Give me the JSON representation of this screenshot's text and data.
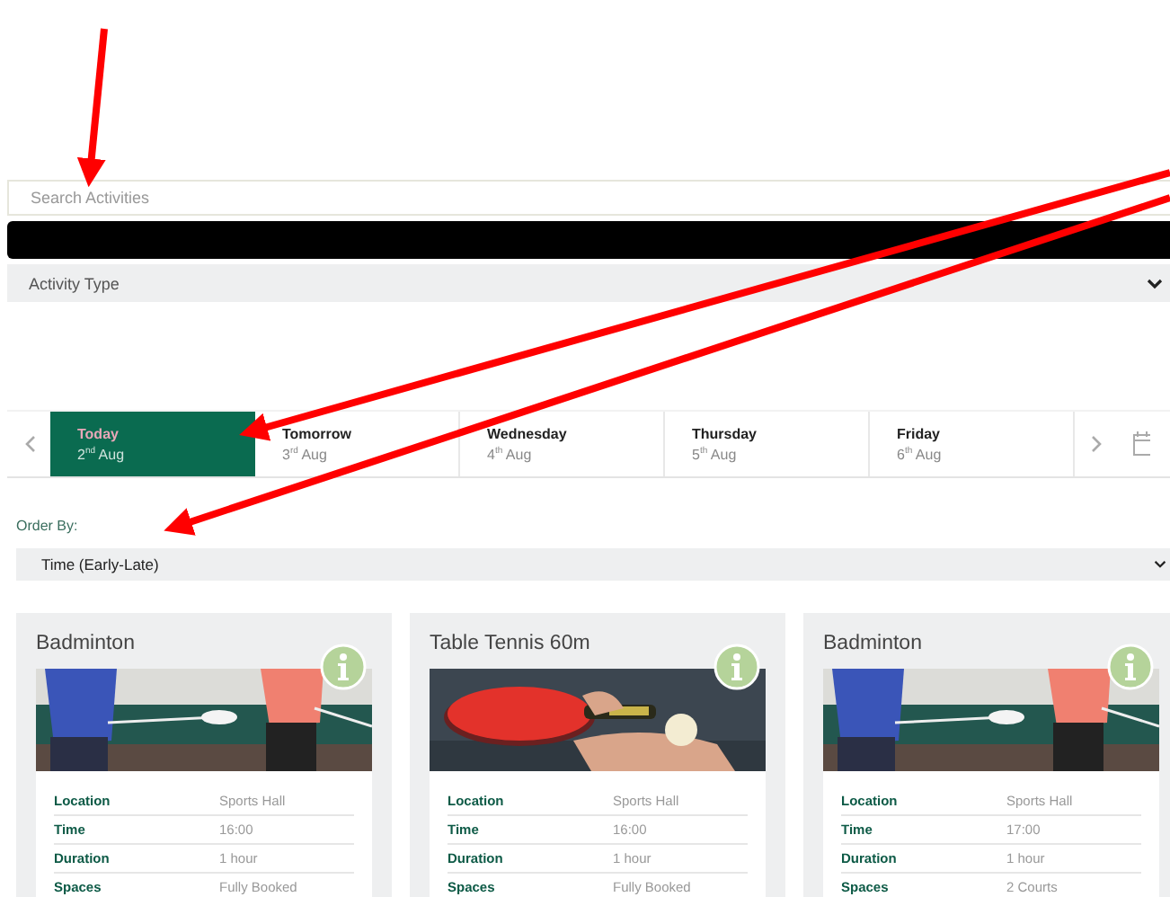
{
  "search": {
    "placeholder": "Search Activities"
  },
  "activity_type": {
    "value": "Activity Type"
  },
  "dates": [
    {
      "day": "Today",
      "date": "2$^{nd}$ Aug",
      "selected": true
    },
    {
      "day": "Tomorrow",
      "date": "3$^{rd}$ Aug",
      "selected": false
    },
    {
      "day": "Wednesday",
      "date": "4$^{th}$ Aug",
      "selected": false
    },
    {
      "day": "Thursday",
      "date": "5$^{th}$ Aug",
      "selected": false
    },
    {
      "day": "Friday",
      "date": "6$^{th}$ Aug",
      "selected": false
    }
  ],
  "order_by": {
    "label": "Order By:",
    "value": "Time (Early-Late)"
  },
  "cards": [
    {
      "title": "Badminton",
      "image": {
        "kind": "picture"
      },
      "details": [
        {
          "label": "Location",
          "value": "Sports Hall"
        },
        {
          "label": "Time",
          "value": "16:00"
        },
        {
          "label": "Duration",
          "value": "1 hour"
        },
        {
          "label": "Spaces",
          "value": "Fully Booked"
        }
      ]
    },
    {
      "title": "Table Tennis 60m",
      "image": {
        "kind": "picture"
      },
      "details": [
        {
          "label": "Location",
          "value": "Sports Hall"
        },
        {
          "label": "Time",
          "value": "16:00"
        },
        {
          "label": "Duration",
          "value": "1 hour"
        },
        {
          "label": "Spaces",
          "value": "Fully Booked"
        }
      ]
    },
    {
      "title": "Badminton",
      "image": {
        "kind": "picture"
      },
      "details": [
        {
          "label": "Location",
          "value": "Sports Hall"
        },
        {
          "label": "Time",
          "value": "17:00"
        },
        {
          "label": "Duration",
          "value": "1 hour"
        },
        {
          "label": "Spaces",
          "value": "2 Courts"
        }
      ]
    }
  ]
}
